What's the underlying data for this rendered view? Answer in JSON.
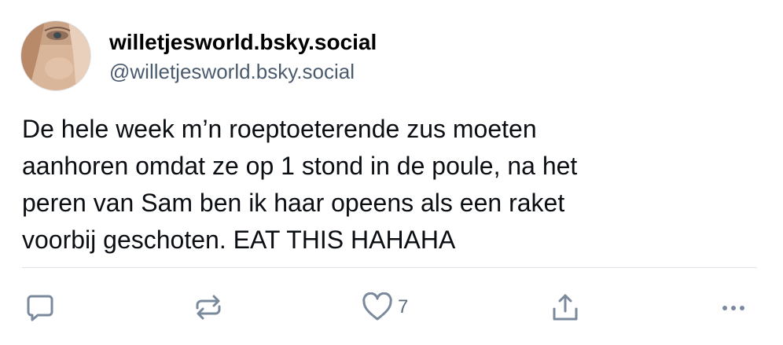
{
  "post": {
    "author": {
      "display_name": "willetjesworld.bsky.social",
      "handle": "@willetjesworld.bsky.social"
    },
    "text": "De hele week m’n roeptoeterende zus moeten\naanhoren omdat ze op 1 stond in de poule, na het\nperen van Sam ben ik haar opeens als een raket\nvoorbij geschoten. EAT THIS HAHAHA",
    "actions": {
      "reply_icon": "speech-bubble-icon",
      "repost_icon": "repost-arrows-icon",
      "like_icon": "heart-icon",
      "like_count": "7",
      "share_icon": "share-up-icon",
      "more_icon": "ellipsis-icon"
    }
  },
  "colors": {
    "icon": "#7a8a9c",
    "handle": "#4b5b6e",
    "divider": "#dde2e8",
    "text": "#0b0f14"
  }
}
